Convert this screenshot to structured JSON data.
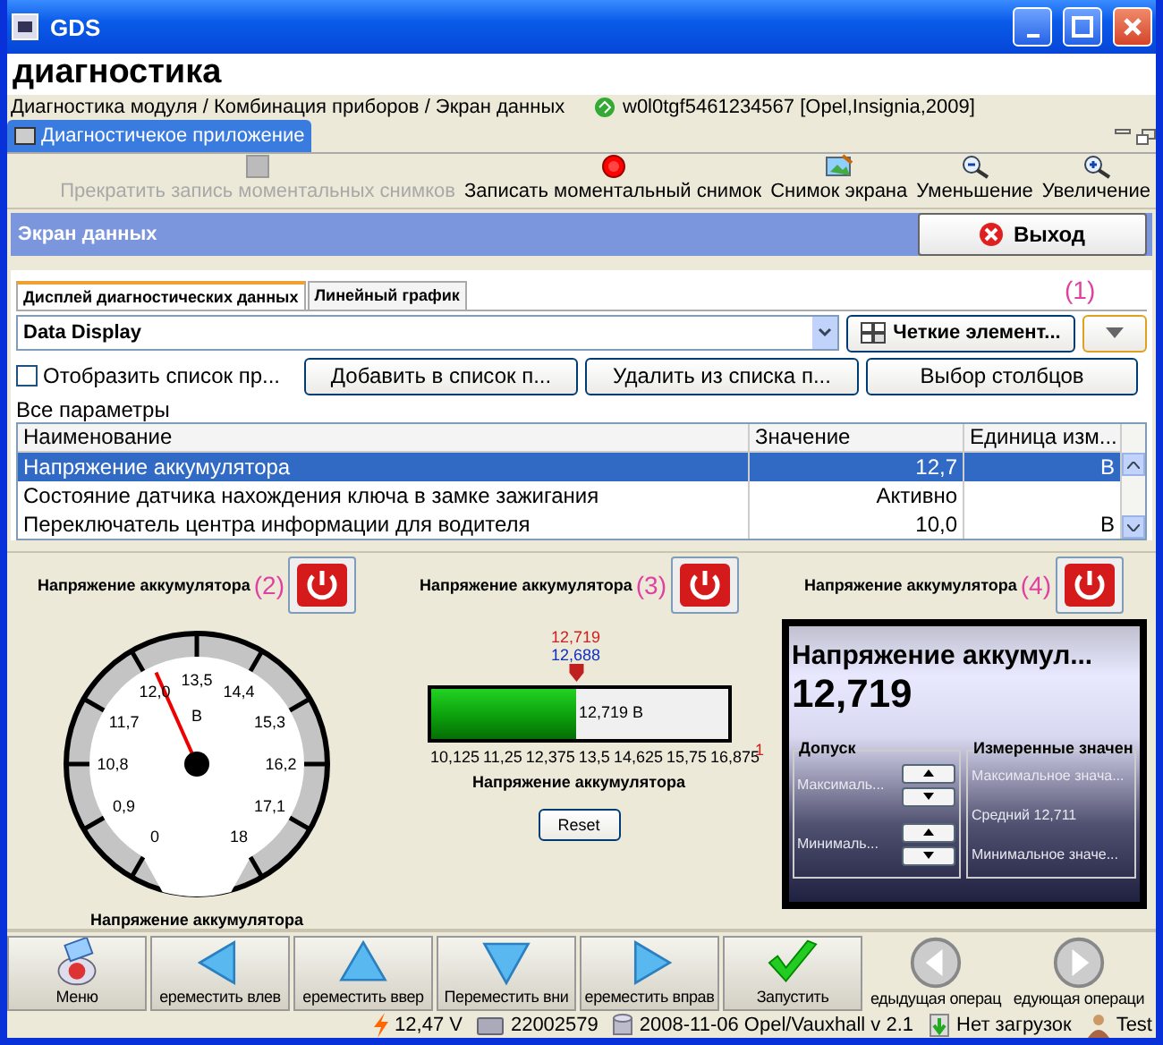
{
  "window": {
    "title": "GDS"
  },
  "app_title": "диагностика",
  "breadcrumb": "Диагностика модуля / Комбинация приборов / Экран данных",
  "vehicle": "w0l0tgf5461234567 [Opel,Insignia,2009]",
  "tabs": [
    {
      "label": "Диагностичекое приложение",
      "selected": true
    }
  ],
  "toolbar": [
    {
      "label": "Прекратить запись моментальных снимков",
      "disabled": true
    },
    {
      "label": "Записать моментальный снимок",
      "disabled": false
    },
    {
      "label": "Снимок экрана",
      "disabled": false
    },
    {
      "label": "Уменьшение",
      "disabled": false
    },
    {
      "label": "Увеличение",
      "disabled": false
    }
  ],
  "screen": {
    "title": "Экран данных",
    "exit": "Выход"
  },
  "view_tabs": [
    {
      "label": "Дисплей диагностических данных",
      "selected": true
    },
    {
      "label": "Линейный график",
      "selected": false
    }
  ],
  "display_select": {
    "value": "Data Display"
  },
  "clear_button": "Четкие элемент...",
  "dropdown_callout": "(1)",
  "show_list": {
    "label": "Отобразить список пр...",
    "checked": false
  },
  "list_buttons": [
    "Добавить в список п...",
    "Удалить из списка п...",
    "Выбор столбцов"
  ],
  "params_label": "Все параметры",
  "table": {
    "columns": [
      "Наименование",
      "Значение",
      "Единица изм..."
    ],
    "rows": [
      {
        "cells": [
          "Напряжение аккумулятора",
          "12,7",
          "В"
        ],
        "selected": true
      },
      {
        "cells": [
          "Состояние датчика нахождения ключа в замке зажигания",
          "Активно",
          ""
        ],
        "selected": false
      },
      {
        "cells": [
          "Переключатель центра информации для водителя",
          "10,0",
          "В"
        ],
        "selected": false
      }
    ]
  },
  "gauges": [
    {
      "kind": "dial",
      "title": "Напряжение аккумулятора",
      "callout": "(2)",
      "ticks": [
        "13,5",
        "12,0",
        "14,4",
        "11,7",
        "15,3",
        "10,8",
        "16,2",
        "0,9",
        "17,1",
        "0",
        "18"
      ],
      "unit": "В",
      "level": 0.42,
      "caption": "Напряжение аккумулятора"
    },
    {
      "kind": "bar",
      "title": "Напряжение аккумулятора",
      "callout": "(3)",
      "marker_value": "12,719",
      "marker_ref": "12,688",
      "reading": "12,719  В",
      "level": 0.49,
      "ticks": [
        "10,125",
        "11,25",
        "12,375",
        "13,5",
        "14,625",
        "15,75",
        "16,875"
      ],
      "caption": "Напряжение аккумулятора",
      "end_mark": "1",
      "reset": "Reset"
    },
    {
      "kind": "digital",
      "title": "Напряжение аккумулятора",
      "callout": "(4)",
      "name": "Напряжение аккумул...",
      "value": "12,719",
      "tolerance": {
        "title": "Допуск",
        "labels": [
          "Максималь...",
          "Минималь..."
        ]
      },
      "measured": {
        "title": "Измеренные значен",
        "lines": [
          "Максимальное знача...",
          "Средний 12,711",
          "Минимальное значе..."
        ]
      }
    }
  ],
  "bottom_bar": [
    {
      "label": "Меню",
      "raised": true
    },
    {
      "label": "ереместить влев",
      "raised": true
    },
    {
      "label": "ереместить ввер",
      "raised": true
    },
    {
      "label": "Переместить вни",
      "raised": true
    },
    {
      "label": "ереместить вправ",
      "raised": true
    },
    {
      "label": "Запустить",
      "raised": true
    },
    {
      "label": "едыдущая операц",
      "raised": false
    },
    {
      "label": "едующая операци",
      "raised": false
    }
  ],
  "status_bar": [
    "12,47 V",
    "22002579",
    "2008-11-06 Opel/Vauxhall v 2.1",
    "Нет загрузок",
    "Test"
  ]
}
